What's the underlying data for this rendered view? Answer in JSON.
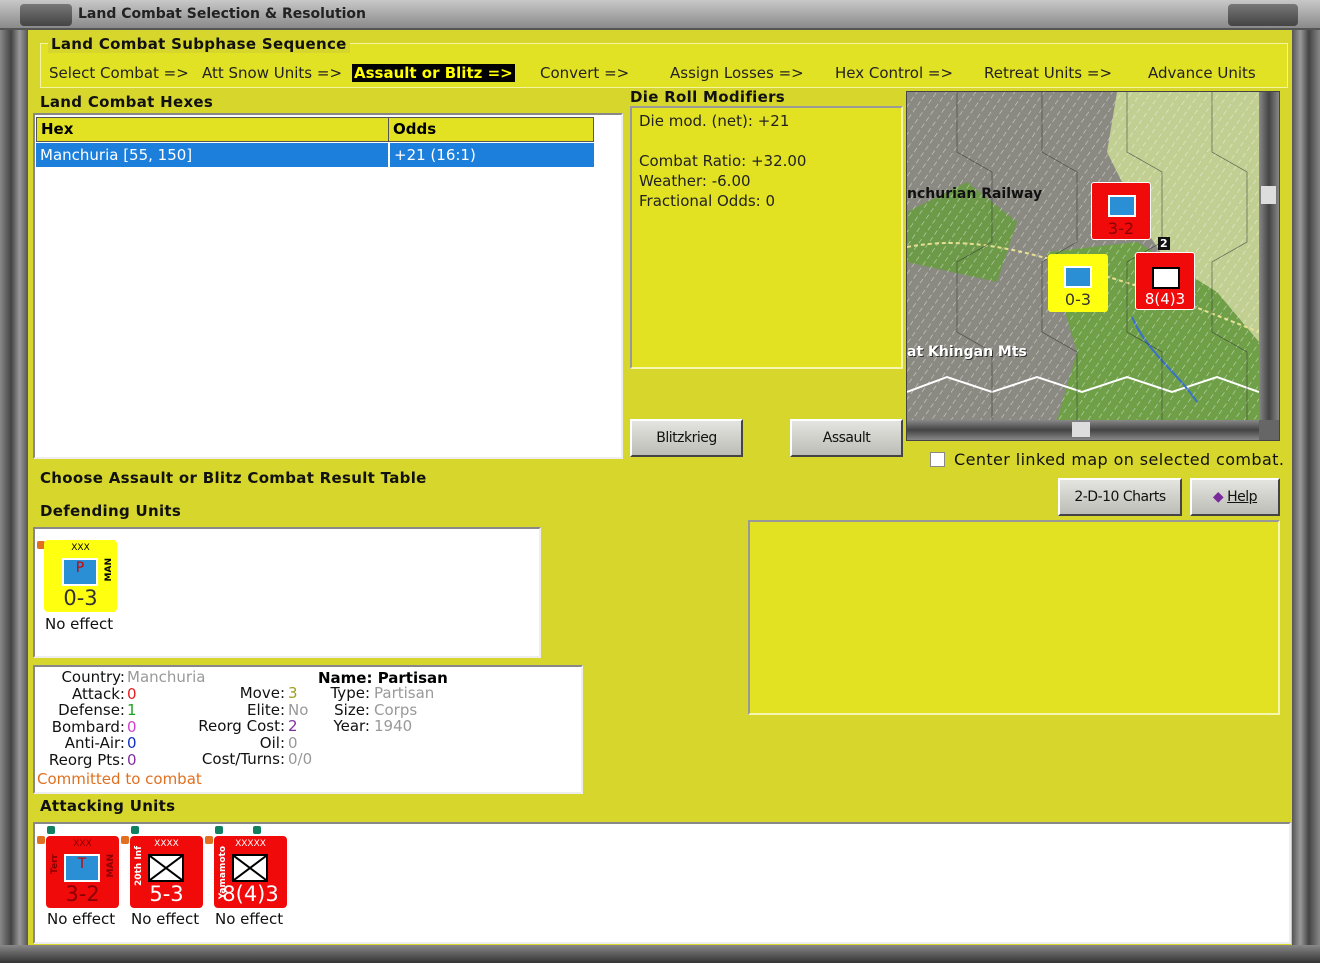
{
  "window": {
    "title": "Land Combat Selection & Resolution"
  },
  "sequence": {
    "title": "Land Combat Subphase Sequence",
    "items": [
      {
        "label": "Select Combat =>",
        "active": false
      },
      {
        "label": "Att Snow Units =>",
        "active": false
      },
      {
        "label": "Assault or Blitz =>",
        "active": true
      },
      {
        "label": "Convert =>",
        "active": false
      },
      {
        "label": "Assign Losses =>",
        "active": false
      },
      {
        "label": "Hex Control =>",
        "active": false
      },
      {
        "label": "Retreat Units =>",
        "active": false
      },
      {
        "label": "Advance Units",
        "active": false
      }
    ]
  },
  "hexes": {
    "title": "Land Combat Hexes",
    "columns": [
      "Hex",
      "Odds"
    ],
    "rows": [
      {
        "hex": "Manchuria [55, 150]",
        "odds": "+21 (16:1)",
        "selected": true
      }
    ]
  },
  "modifiers": {
    "title": "Die Roll Modifiers",
    "net": "Die mod. (net): +21",
    "lines": [
      "Combat Ratio: +32.00",
      "Weather: -6.00",
      "Fractional Odds: 0"
    ]
  },
  "buttons": {
    "blitz": "Blitzkrieg",
    "assault": "Assault",
    "charts": "2-D-10 Charts",
    "help": "Help"
  },
  "map": {
    "labels": [
      "nchurian Railway",
      "at Khingan Mts"
    ],
    "stack_count": "2",
    "units": [
      {
        "strength": "3-2",
        "size": "XXX",
        "color": "red"
      },
      {
        "strength": "0-3",
        "size": "XXX",
        "color": "yellow"
      },
      {
        "strength": "8(4)3",
        "size": "XXXXX",
        "color": "red"
      }
    ]
  },
  "center_checkbox": {
    "label": "Center linked map on selected combat.",
    "checked": false
  },
  "choose_label": "Choose Assault or Blitz Combat Result Table",
  "defending": {
    "title": "Defending Units",
    "units": [
      {
        "size": "XXX",
        "left": "",
        "right": "MAN",
        "strength": "0-3",
        "result": "No effect",
        "symbol": "P"
      }
    ]
  },
  "info": {
    "country_k": "Country:",
    "country": "Manchuria",
    "attack_k": "Attack:",
    "attack": "0",
    "defense_k": "Defense:",
    "defense": "1",
    "bombard_k": "Bombard:",
    "bombard": "0",
    "aa_k": "Anti-Air:",
    "aa": "0",
    "reorgpts_k": "Reorg Pts:",
    "reorgpts": "0",
    "move_k": "Move:",
    "move": "3",
    "elite_k": "Elite:",
    "elite": "No",
    "reorgcost_k": "Reorg Cost:",
    "reorgcost": "2",
    "oil_k": "Oil:",
    "oil": "0",
    "cost_k": "Cost/Turns:",
    "cost": "0/0",
    "name": "Name: Partisan",
    "type_k": "Type:",
    "type": "Partisan",
    "size_k": "Size:",
    "size": "Corps",
    "year_k": "Year:",
    "year": "1940",
    "status": "Committed to combat"
  },
  "attacking": {
    "title": "Attacking Units",
    "units": [
      {
        "size": "XXX",
        "left": "Terr",
        "right": "MAN",
        "strength": "3-2",
        "result": "No effect",
        "symbol": "T"
      },
      {
        "size": "XXXX",
        "left": "20th Inf",
        "right": "",
        "strength": "5-3",
        "result": "No effect",
        "symbol": "X"
      },
      {
        "size": "XXXXX",
        "left": "Yamamoto",
        "right": "",
        "strength": "8(4)3",
        "result": "No effect",
        "symbol": "X"
      }
    ]
  },
  "colors": {
    "panel": "#d6d62c",
    "selected": "#1c7fdb",
    "attacker": "#f00a0a",
    "defender": "#ffff10",
    "status": "#e07020"
  }
}
